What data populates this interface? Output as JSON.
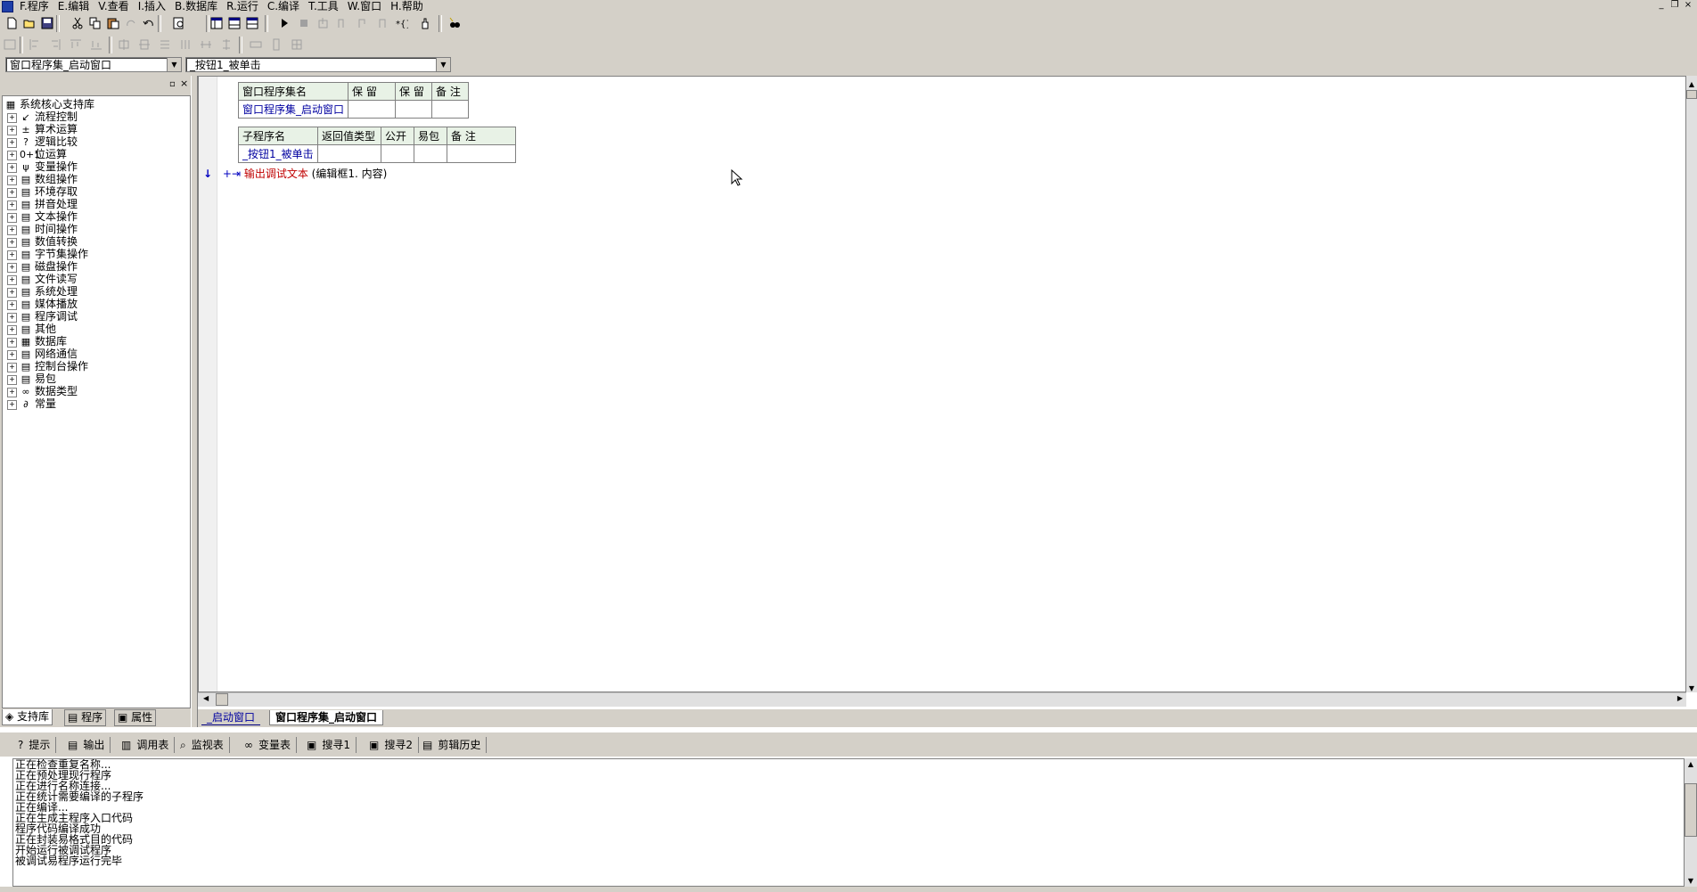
{
  "menu": {
    "items": [
      "F.程序",
      "E.编辑",
      "V.查看",
      "I.插入",
      "B.数据库",
      "R.运行",
      "C.编译",
      "T.工具",
      "W.窗口",
      "H.帮助"
    ]
  },
  "toolbar1": {
    "icons": [
      "new-file-icon",
      "open-icon",
      "save-icon",
      "cut-icon",
      "copy-icon",
      "paste-icon",
      "redo-icon",
      "undo-icon",
      "find-icon",
      "layout1-icon",
      "layout2-icon",
      "layout3-icon",
      "run-icon",
      "stop-icon",
      "step-in-icon",
      "step-over-icon",
      "step-out-icon",
      "run-to-cursor-icon",
      "breakpoint-icon",
      "hand-icon",
      "debug-find-icon"
    ]
  },
  "combos": {
    "assembly": "窗口程序集_启动窗口",
    "subroutine": "_按钮1_被单击"
  },
  "library_tree": {
    "root": "系统核心支持库",
    "items": [
      {
        "label": "流程控制",
        "icon": "flow-control-icon",
        "glyph": "↙"
      },
      {
        "label": "算术运算",
        "icon": "arithmetic-icon",
        "glyph": "±"
      },
      {
        "label": "逻辑比较",
        "icon": "logic-compare-icon",
        "glyph": "?"
      },
      {
        "label": "位运算",
        "icon": "bit-op-icon",
        "glyph": "0+1"
      },
      {
        "label": "变量操作",
        "icon": "variable-op-icon",
        "glyph": "ψ"
      },
      {
        "label": "数组操作",
        "icon": "array-op-icon",
        "glyph": "▤"
      },
      {
        "label": "环境存取",
        "icon": "env-access-icon",
        "glyph": "▤"
      },
      {
        "label": "拼音处理",
        "icon": "pinyin-icon",
        "glyph": "▤"
      },
      {
        "label": "文本操作",
        "icon": "text-op-icon",
        "glyph": "▤"
      },
      {
        "label": "时间操作",
        "icon": "time-op-icon",
        "glyph": "▤"
      },
      {
        "label": "数值转换",
        "icon": "number-convert-icon",
        "glyph": "▤"
      },
      {
        "label": "字节集操作",
        "icon": "byteset-op-icon",
        "glyph": "▤"
      },
      {
        "label": "磁盘操作",
        "icon": "disk-op-icon",
        "glyph": "▤"
      },
      {
        "label": "文件读写",
        "icon": "file-rw-icon",
        "glyph": "▤"
      },
      {
        "label": "系统处理",
        "icon": "system-icon",
        "glyph": "▤"
      },
      {
        "label": "媒体播放",
        "icon": "media-icon",
        "glyph": "▤"
      },
      {
        "label": "程序调试",
        "icon": "debug-icon",
        "glyph": "▤"
      },
      {
        "label": "其他",
        "icon": "other-icon",
        "glyph": "▤"
      },
      {
        "label": "数据库",
        "icon": "database-icon",
        "glyph": "▦"
      },
      {
        "label": "网络通信",
        "icon": "network-icon",
        "glyph": "▤"
      },
      {
        "label": "控制台操作",
        "icon": "console-icon",
        "glyph": "▤"
      },
      {
        "label": "易包",
        "icon": "epackage-icon",
        "glyph": "▤"
      },
      {
        "label": "数据类型",
        "icon": "datatype-icon",
        "glyph": "∞"
      },
      {
        "label": "常量",
        "icon": "constant-icon",
        "glyph": "∂"
      }
    ]
  },
  "left_tabs": [
    "支持库",
    "程序",
    "属性"
  ],
  "editor": {
    "assembly_table": {
      "headers": [
        "窗口程序集名",
        "保 留",
        "保 留",
        "备 注"
      ],
      "row": [
        "窗口程序集_启动窗口",
        "",
        "",
        ""
      ]
    },
    "sub_table": {
      "headers": [
        "子程序名",
        "返回值类型",
        "公开",
        "易包",
        "备 注"
      ],
      "row": [
        "_按钮1_被单击",
        "",
        "",
        "",
        ""
      ]
    },
    "code_line": {
      "marker": "↓",
      "expand": "+⇥",
      "call": "输出调试文本",
      "args": "(编辑框1. 内容)"
    }
  },
  "doc_tabs": [
    "_启动窗口",
    "窗口程序集_启动窗口"
  ],
  "output_tabs": [
    {
      "label": "提示",
      "icon": "hint-icon",
      "glyph": "?"
    },
    {
      "label": "输出",
      "icon": "output-icon",
      "glyph": "▤"
    },
    {
      "label": "调用表",
      "icon": "callstack-icon",
      "glyph": "▥"
    },
    {
      "label": "监视表",
      "icon": "watch-icon",
      "glyph": "⌕"
    },
    {
      "label": "变量表",
      "icon": "variables-icon",
      "glyph": "∞"
    },
    {
      "label": "搜寻1",
      "icon": "search1-icon",
      "glyph": "▣"
    },
    {
      "label": "搜寻2",
      "icon": "search2-icon",
      "glyph": "▣"
    },
    {
      "label": "剪辑历史",
      "icon": "clip-history-icon",
      "glyph": "▤"
    }
  ],
  "output_lines": [
    "正在检查重复名称...",
    "正在预处理现行程序",
    "正在进行名称连接...",
    "正在统计需要编译的子程序",
    "正在编译...",
    "正在生成主程序入口代码",
    "程序代码编译成功",
    "正在封装易格式目的代码",
    "开始运行被调试程序",
    "被调试易程序运行完毕"
  ],
  "colors": {
    "chrome": "#d4d0c8",
    "table_header": "#e8f2e6",
    "name_blue": "#0000a0",
    "call_red": "#c00000"
  }
}
